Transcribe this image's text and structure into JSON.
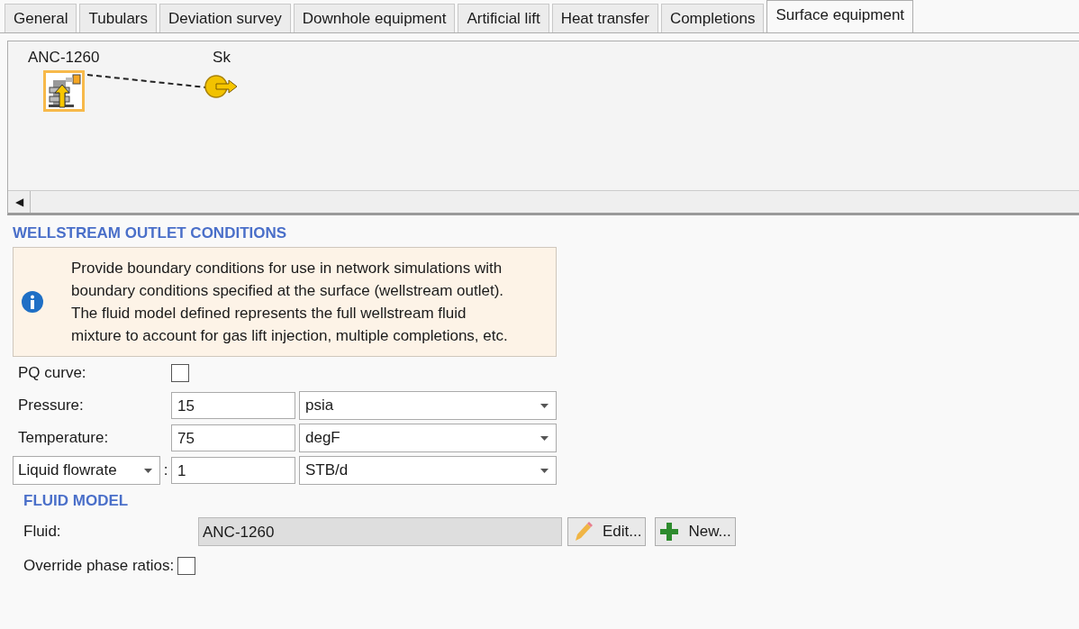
{
  "tabs": [
    {
      "label": "General",
      "selected": false
    },
    {
      "label": "Tubulars",
      "selected": false
    },
    {
      "label": "Deviation survey",
      "selected": false
    },
    {
      "label": "Downhole equipment",
      "selected": false
    },
    {
      "label": "Artificial lift",
      "selected": false
    },
    {
      "label": "Heat transfer",
      "selected": false
    },
    {
      "label": "Completions",
      "selected": false
    },
    {
      "label": "Surface equipment",
      "selected": true
    }
  ],
  "diagram": {
    "nodes": [
      {
        "label": "ANC-1260",
        "kind": "well",
        "selected": true
      },
      {
        "label": "Sk",
        "kind": "sink",
        "selected": false
      }
    ],
    "scroll_arrow": "◀"
  },
  "outlet": {
    "heading": "WELLSTREAM OUTLET CONDITIONS",
    "info": "Provide boundary conditions for use in network simulations with boundary conditions specified at the surface (wellstream outlet).  The fluid model defined represents the full wellstream fluid mixture to account for gas lift injection, multiple completions, etc.",
    "pq_curve": {
      "label": "PQ curve:",
      "checked": false
    },
    "rows": [
      {
        "kind": "label",
        "label": "Pressure:",
        "value": "15",
        "unit": "psia"
      },
      {
        "kind": "label",
        "label": "Temperature:",
        "value": "75",
        "unit": "degF"
      },
      {
        "kind": "selector",
        "label": "Liquid flowrate",
        "separator": ":",
        "value": "1",
        "unit": "STB/d"
      }
    ]
  },
  "fluid_model": {
    "heading": "FLUID MODEL",
    "label": "Fluid:",
    "value": "ANC-1260",
    "buttons": [
      {
        "kind": "edit",
        "label": "Edit..."
      },
      {
        "kind": "new",
        "label": "New..."
      }
    ],
    "override": {
      "label": "Override phase ratios:",
      "checked": false
    }
  }
}
